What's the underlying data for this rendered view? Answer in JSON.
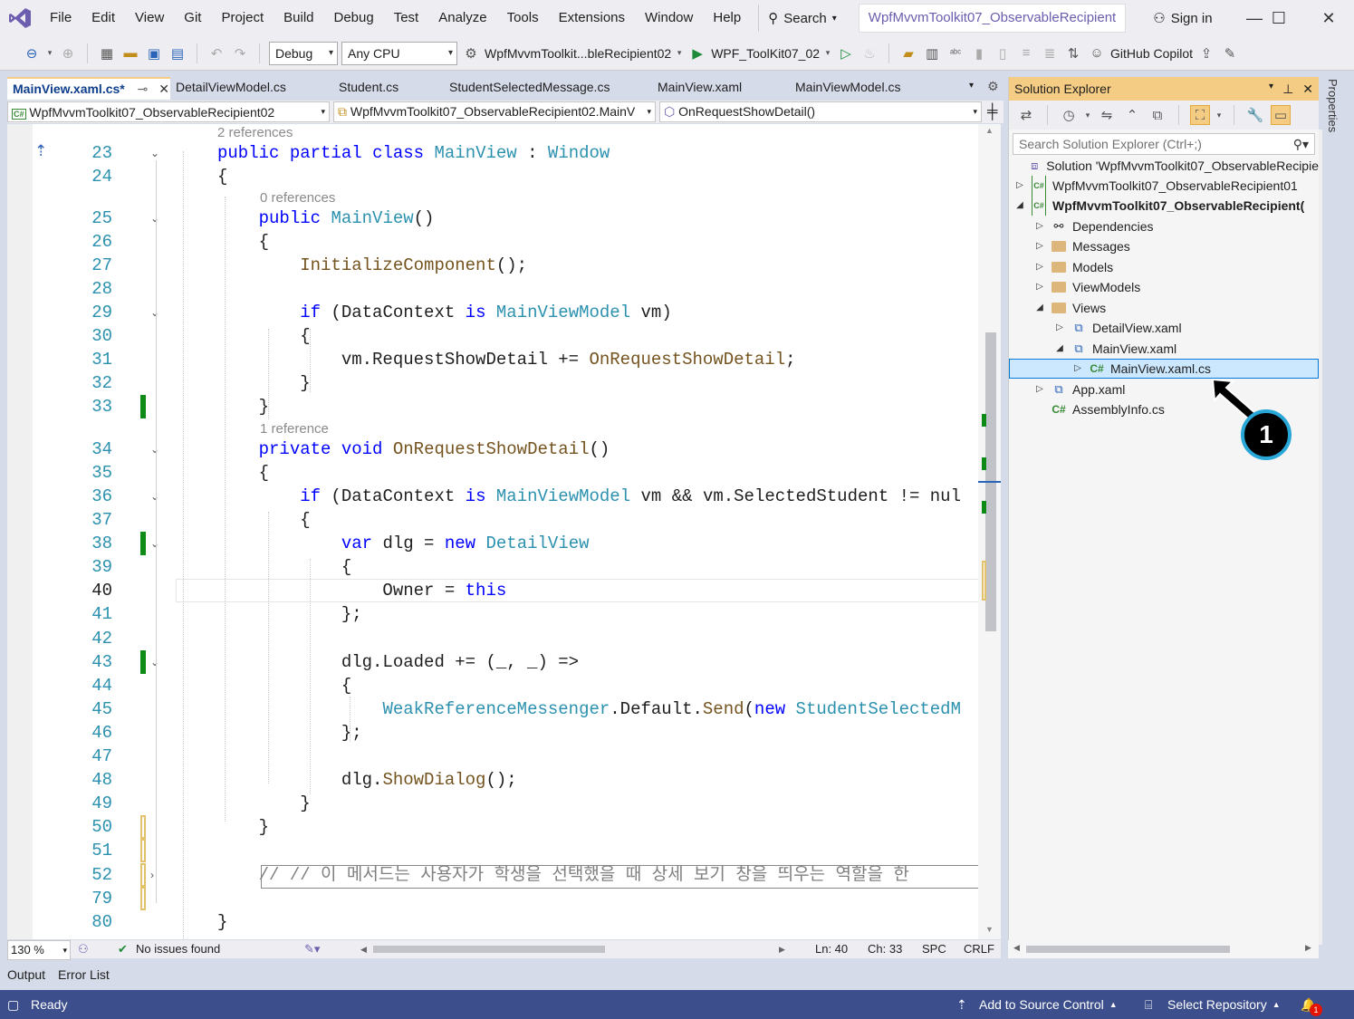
{
  "menu": {
    "items": [
      "File",
      "Edit",
      "View",
      "Git",
      "Project",
      "Build",
      "Debug",
      "Test",
      "Analyze",
      "Tools",
      "Extensions",
      "Window",
      "Help"
    ],
    "search_label": "Search",
    "window_title": "WpfMvvmToolkit07_ObservableRecipient",
    "sign_in": "Sign in"
  },
  "toolbar": {
    "config": "Debug",
    "platform": "Any CPU",
    "startup_project": "WpfMvvmToolkit...bleRecipient02",
    "run_target": "WPF_ToolKit07_02",
    "copilot": "GitHub Copilot"
  },
  "tabs": [
    {
      "label": "MainView.xaml.cs*",
      "active": true
    },
    {
      "label": "DetailViewModel.cs",
      "active": false
    },
    {
      "label": "Student.cs",
      "active": false
    },
    {
      "label": "StudentSelectedMessage.cs",
      "active": false
    },
    {
      "label": "MainView.xaml",
      "active": false
    },
    {
      "label": "MainViewModel.cs",
      "active": false
    }
  ],
  "navbar": {
    "project": "WpfMvvmToolkit07_ObservableRecipient02",
    "type": "WpfMvvmToolkit07_ObservableRecipient02.MainV",
    "member": "OnRequestShowDetail()"
  },
  "code": {
    "lens_23": "2 references",
    "lens_25": "0 references",
    "lens_34": "1 reference",
    "lines": [
      {
        "n": "23",
        "t": "public partial class MainView : Window"
      },
      {
        "n": "24",
        "t": "{"
      },
      {
        "n": "25",
        "t": "    public MainView()"
      },
      {
        "n": "26",
        "t": "    {"
      },
      {
        "n": "27",
        "t": "        InitializeComponent();"
      },
      {
        "n": "28",
        "t": ""
      },
      {
        "n": "29",
        "t": "        if (DataContext is MainViewModel vm)"
      },
      {
        "n": "30",
        "t": "        {"
      },
      {
        "n": "31",
        "t": "            vm.RequestShowDetail += OnRequestShowDetail;"
      },
      {
        "n": "32",
        "t": "        }"
      },
      {
        "n": "33",
        "t": "    }"
      },
      {
        "n": "34",
        "t": "    private void OnRequestShowDetail()"
      },
      {
        "n": "35",
        "t": "    {"
      },
      {
        "n": "36",
        "t": "        if (DataContext is MainViewModel vm && vm.SelectedStudent != nul"
      },
      {
        "n": "37",
        "t": "        {"
      },
      {
        "n": "38",
        "t": "            var dlg = new DetailView"
      },
      {
        "n": "39",
        "t": "            {"
      },
      {
        "n": "40",
        "t": "                Owner = this"
      },
      {
        "n": "41",
        "t": "            };"
      },
      {
        "n": "42",
        "t": ""
      },
      {
        "n": "43",
        "t": "            dlg.Loaded += (_, _) =>"
      },
      {
        "n": "44",
        "t": "            {"
      },
      {
        "n": "45",
        "t": "                WeakReferenceMessenger.Default.Send(new StudentSelectedM"
      },
      {
        "n": "46",
        "t": "            };"
      },
      {
        "n": "47",
        "t": ""
      },
      {
        "n": "48",
        "t": "            dlg.ShowDialog();"
      },
      {
        "n": "49",
        "t": "        }"
      },
      {
        "n": "50",
        "t": "    }"
      },
      {
        "n": "51",
        "t": ""
      },
      {
        "n": "52",
        "t": "    // // 이 메서드는 사용자가 학생을 선택했을 때 상세 보기 창을 띄우는 역할을 한"
      },
      {
        "n": "79",
        "t": ""
      },
      {
        "n": "80",
        "t": "}"
      }
    ]
  },
  "editor_status": {
    "zoom": "130 %",
    "issues": "No issues found",
    "ln": "Ln: 40",
    "ch": "Ch: 33",
    "spc": "SPC",
    "crlf": "CRLF"
  },
  "solution_explorer": {
    "title": "Solution Explorer",
    "search_placeholder": "Search Solution Explorer (Ctrl+;)",
    "nodes": [
      {
        "label": "Solution 'WpfMvvmToolkit07_ObservableRecipie",
        "icon": "solution-icon"
      },
      {
        "label": "WpfMvvmToolkit07_ObservableRecipient01",
        "icon": "csproj-icon"
      },
      {
        "label": "WpfMvvmToolkit07_ObservableRecipient(",
        "icon": "csproj-icon"
      },
      {
        "label": "Dependencies",
        "icon": "dependencies-icon"
      },
      {
        "label": "Messages",
        "icon": "folder-icon"
      },
      {
        "label": "Models",
        "icon": "folder-icon"
      },
      {
        "label": "ViewModels",
        "icon": "folder-icon"
      },
      {
        "label": "Views",
        "icon": "folder-icon"
      },
      {
        "label": "DetailView.xaml",
        "icon": "xaml-icon"
      },
      {
        "label": "MainView.xaml",
        "icon": "xaml-icon"
      },
      {
        "label": "MainView.xaml.cs",
        "icon": "csharp-file-icon"
      },
      {
        "label": "App.xaml",
        "icon": "xaml-icon"
      },
      {
        "label": "AssemblyInfo.cs",
        "icon": "csharp-file-icon"
      }
    ]
  },
  "properties_tab": "Properties",
  "bottom_tabs": [
    "Output",
    "Error List"
  ],
  "statusbar": {
    "ready": "Ready",
    "source_control": "Add to Source Control",
    "repository": "Select Repository",
    "notifications": "1"
  },
  "callout": {
    "number": "1"
  },
  "colors": {
    "accent": "#6c5dae",
    "statusbar": "#3c4f8c",
    "active_tab_border": "#f5cc84",
    "selection": "#cce8ff"
  }
}
